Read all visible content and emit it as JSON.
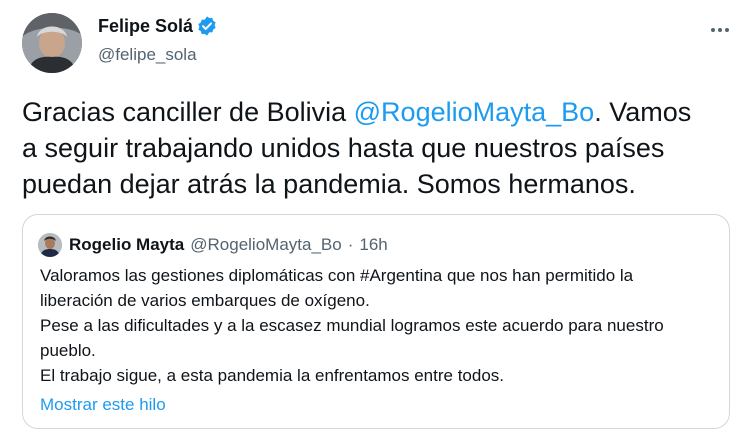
{
  "author": {
    "name": "Felipe Solá",
    "handle": "@felipe_sola",
    "verified": true
  },
  "more_menu_icon": "more-horizontal-icon",
  "tweet": {
    "text_before": "Gracias canciller de Bolivia ",
    "mention": "@RogelioMayta_Bo",
    "text_line1_after": ". Vamos",
    "line2": "a seguir trabajando unidos hasta que nuestros países",
    "line3": "puedan dejar atrás la pandemia. Somos hermanos."
  },
  "quoted_tweet": {
    "name": "Rogelio Mayta",
    "handle": "@RogelioMayta_Bo",
    "separator": "·",
    "time": "16h",
    "lines": [
      "Valoramos las gestiones diplomáticas con #Argentina que nos han permitido la",
      "liberación de varios embarques de oxígeno.",
      "Pese a las dificultades y a la escasez mundial logramos este acuerdo para nuestro",
      "pueblo.",
      "El trabajo sigue, a esta pandemia la enfrentamos entre todos."
    ],
    "show_thread": "Mostrar este hilo"
  },
  "colors": {
    "link": "#1d9bf0",
    "text": "#0f1419",
    "secondary": "#536471",
    "border": "#cfd9de"
  }
}
